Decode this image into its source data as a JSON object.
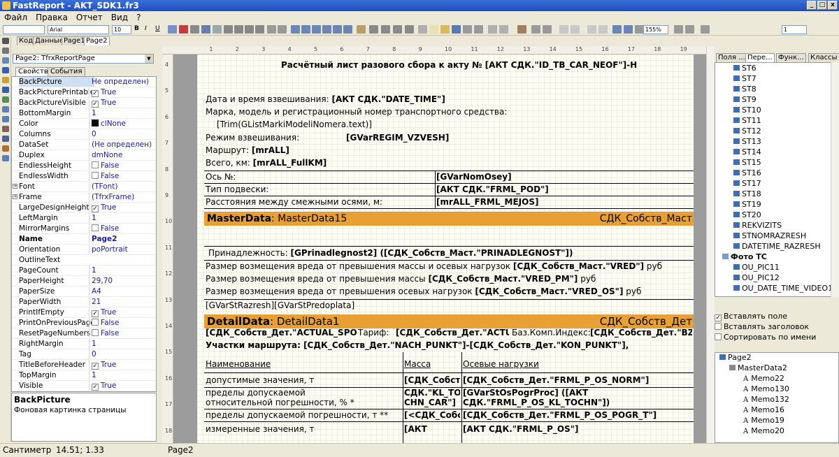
{
  "title": "FastReport - AKT_SDK1.fr3",
  "menu": [
    "Файл",
    "Правка",
    "Отчет",
    "Вид",
    "?"
  ],
  "toolbar": {
    "font_name": "Arial",
    "font_size": "10",
    "bold": "B",
    "italic": "I",
    "underline": "U",
    "zoom": "155%",
    "page_num": "1"
  },
  "page_tabs": [
    "Код",
    "Данные",
    "Page1",
    "Page2"
  ],
  "object_selector": "Page2: TfrxReportPage",
  "inspector_tabs": [
    "Свойства",
    "События"
  ],
  "properties": [
    {
      "name": "BackPicture",
      "value": "Не определен)",
      "sel": true
    },
    {
      "name": "BackPicturePrintable",
      "value": "True",
      "check": true
    },
    {
      "name": "BackPictureVisible",
      "value": "True",
      "check": true
    },
    {
      "name": "BottomMargin",
      "value": "1"
    },
    {
      "name": "Color",
      "value": "clNone",
      "color": "#000000"
    },
    {
      "name": "Columns",
      "value": "0"
    },
    {
      "name": "DataSet",
      "value": "(Не определен)"
    },
    {
      "name": "Duplex",
      "value": "dmNone"
    },
    {
      "name": "EndlessHeight",
      "value": "False",
      "check": false
    },
    {
      "name": "EndlessWidth",
      "value": "False",
      "check": false
    },
    {
      "name": "Font",
      "value": "(TFont)",
      "expand": true
    },
    {
      "name": "Frame",
      "value": "(TfrxFrame)",
      "expand": true
    },
    {
      "name": "LargeDesignHeight",
      "value": "True",
      "check": true
    },
    {
      "name": "LeftMargin",
      "value": "1"
    },
    {
      "name": "MirrorMargins",
      "value": "False",
      "check": false
    },
    {
      "name": "Name",
      "value": "Page2",
      "bold": true
    },
    {
      "name": "Orientation",
      "value": "poPortrait"
    },
    {
      "name": "OutlineText",
      "value": ""
    },
    {
      "name": "PageCount",
      "value": "1"
    },
    {
      "name": "PaperHeight",
      "value": "29,70"
    },
    {
      "name": "PaperSize",
      "value": "A4"
    },
    {
      "name": "PaperWidth",
      "value": "21"
    },
    {
      "name": "PrintIfEmpty",
      "value": "True",
      "check": true
    },
    {
      "name": "PrintOnPreviousPage",
      "value": "False",
      "check": false
    },
    {
      "name": "ResetPageNumbers",
      "value": "False",
      "check": false
    },
    {
      "name": "RightMargin",
      "value": "1"
    },
    {
      "name": "Tag",
      "value": "0"
    },
    {
      "name": "TitleBeforeHeader",
      "value": "True",
      "check": true
    },
    {
      "name": "TopMargin",
      "value": "1"
    },
    {
      "name": "Visible",
      "value": "True",
      "check": true
    }
  ],
  "help": {
    "title": "BackPicture",
    "desc": "Фоновая картинка страницы"
  },
  "report": {
    "header": "Расчётный лист разового сбора к акту № [АКТ СДК.\"ID_TB_CAR_NEOF\"]-Н",
    "date_label": "Дата и время взвешивания:",
    "date_field": "[АКТ СДК.\"DATE_TIME\"]",
    "car_label": "Марка, модель и регистрационный номер транспортного средства:",
    "car_field": "[Trim(GListMarkiModeliNomera.text)]",
    "mode_label": "Режим взвешивания:",
    "mode_field": "[GVarREGIM_VZVESH]",
    "route_label": "Маршрут:",
    "route_field": "[mrALL]",
    "total_label": "Всего, км:",
    "total_field": "[mrALL_FullKM]",
    "axis_rows": [
      {
        "label": "Ось №:",
        "value": "[GVarNomOsey]"
      },
      {
        "label": "Тип подвески:",
        "value": "[АКТ СДК.\"FRML_POD\"]"
      },
      {
        "label": "Расстояния между смежными осями, м:",
        "value": "[mrALL_FRML_MEJOS]"
      }
    ],
    "master_band": {
      "kind": "MasterData",
      "sep": ":",
      "name": "MasterData15",
      "ds": "СДК_Собств_Маст"
    },
    "owner_label": "Принадлежность:",
    "owner_field": "[GPrinadlegnost2] ([СДК_Собств_Маст.\"PRINADLEGNOST\"])",
    "damage_rows": [
      {
        "text": "Размер возмещения вреда от превышения массы и осевых нагрузок",
        "field": "[СДК_Собств_Маст.\"VRED\"]",
        "unit": "руб"
      },
      {
        "text": "Размер возмещения вреда от превышения массы",
        "field": "[СДК_Собств_Маст.\"VRED_PM\"]",
        "unit": "руб"
      },
      {
        "text": "Размер возмещения вреда от превышения осевых нагрузок",
        "field": "[СДК_Собств_Маст.\"VRED_OS\"]",
        "unit": "руб"
      }
    ],
    "razrezh": "[GVarStRazresh][GVarStPredoplata]",
    "detail_band": {
      "kind": "DetailData",
      "sep": ":",
      "name": "DetailData1",
      "ds": "СДК_Собств_Дет"
    },
    "detail_row1": [
      "[СДК_Собств_Дет.\"ACTUAL_SPO",
      "Тариф:",
      "[СДК_Собств_Дет.\"ACTU",
      "Баз.Комп.Индекс:",
      "[СДК_Собств_Дет.\"BZ"
    ],
    "route_sections": "Участки маршрута: [СДК_Собств_Дет.\"NACH_PUNKT\"]-[СДК_Собств_Дет.\"KON_PUNKT\"],",
    "table_head": [
      "Наименование",
      "Масса",
      "Осевые нагрузки"
    ],
    "table_rows": [
      {
        "c1": "допустимые значения, т",
        "c2": "[СДК_Собст",
        "c3": "[СДК_Собств_Дет.\"FRML_P_OS_NORM\"]"
      },
      {
        "c1": "пределы допускаемой",
        "c1b": "относительной погрешности, % *",
        "c2": "СДК.\"KL_TO",
        "c2b": "CHN_CAR\"]",
        "c3": "[GVarStOsPogrProc] ([АКТ",
        "c3b": "СДК.\"FRML_P_OS_KL_TOCHN\"])"
      },
      {
        "c1": "пределы допускаемой погрешности, т **",
        "c2": "[<СДК_Собс",
        "c3": "[СДК_Собств_Дет.\"FRML_P_OS_POGR_T\"]"
      },
      {
        "c1": "измеренные значения, т",
        "c2": "[АКТ",
        "c3": "[АКТ СДК.\"FRML_P_OS\"]"
      }
    ]
  },
  "right_tabs": [
    "Поля ...",
    "Пере...",
    "Функ...",
    "Классы"
  ],
  "fields": [
    "ST6",
    "ST7",
    "ST8",
    "ST9",
    "ST10",
    "ST11",
    "ST12",
    "ST13",
    "ST14",
    "ST15",
    "ST16",
    "ST17",
    "ST18",
    "ST19",
    "ST20",
    "REKVIZITS",
    "STNOMRAZRESH",
    "DATETIME_RAZRESH"
  ],
  "photo_group": "Фото ТС",
  "photo_fields": [
    "OU_PIC11",
    "OU_PIC12",
    "OU_DATE_TIME_VIDEO1"
  ],
  "options": [
    {
      "label": "Вставлять поле",
      "checked": true
    },
    {
      "label": "Вставлять заголовок",
      "checked": false
    },
    {
      "label": "Сортировать по имени",
      "checked": false
    }
  ],
  "report_tree": {
    "root": "Page2",
    "band": "MasterData2",
    "items": [
      "Memo22",
      "Memo130",
      "Memo132",
      "Memo16",
      "Memo19",
      "Memo20"
    ]
  },
  "status": {
    "units": "Сантиметр",
    "coords": "14.51; 1.33",
    "page": "Page2"
  }
}
